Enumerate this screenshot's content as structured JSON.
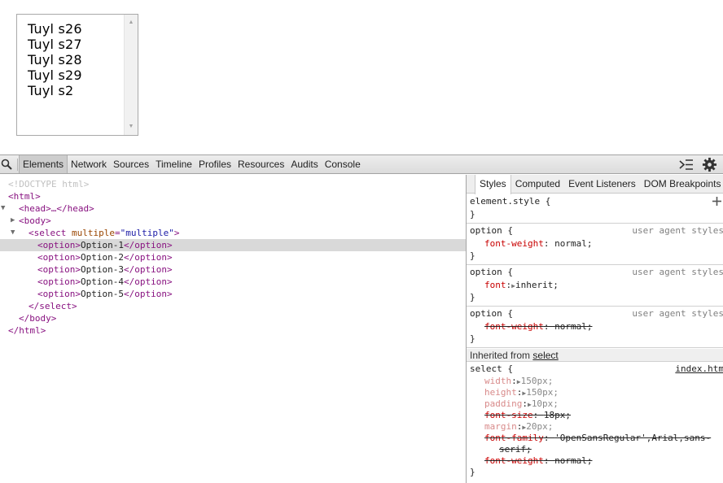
{
  "preview": {
    "options": [
      "Tuyl s26",
      "Tuyl s27",
      "Tuyl s28",
      "Tuyl s29",
      "Tuyl s2"
    ]
  },
  "toolbar": {
    "tabs": [
      "Elements",
      "Network",
      "Sources",
      "Timeline",
      "Profiles",
      "Resources",
      "Audits",
      "Console"
    ],
    "active_tab": "Elements"
  },
  "dom": {
    "doctype": "<!DOCTYPE html>",
    "html_open": "<html>",
    "head_collapsed": "<head>…</head>",
    "body_open": "<body>",
    "select_tag": "select",
    "select_attr_name": "multiple",
    "select_attr_value": "\"multiple\"",
    "options": [
      "Option-1",
      "Option-2",
      "Option-3",
      "Option-4",
      "Option-5"
    ],
    "option_open": "<option>",
    "option_close": "</option>",
    "select_close": "</select>",
    "body_close": "</body>",
    "html_close": "</html>"
  },
  "styles": {
    "subtabs": [
      "Styles",
      "Computed",
      "Event Listeners",
      "DOM Breakpoints"
    ],
    "element_style": "element.style {",
    "close_brace": "}",
    "rules": [
      {
        "selector": "option {",
        "source": "user agent styles",
        "prop": "font-weight",
        "value": "normal;"
      },
      {
        "selector": "option {",
        "source": "user agent styles",
        "prop": "font",
        "value": "inherit;"
      },
      {
        "selector": "option {",
        "source": "user agent styles",
        "prop": "font-weight",
        "value": "normal;"
      }
    ],
    "inherited_label": "Inherited from",
    "inherited_link": "select",
    "select_rule": {
      "selector": "select {",
      "source": "index.htm",
      "props": [
        {
          "name": "width",
          "value": "150px;"
        },
        {
          "name": "height",
          "value": "150px;"
        },
        {
          "name": "padding",
          "value": "10px;"
        },
        {
          "name": "font-size",
          "value": "18px;"
        },
        {
          "name": "margin",
          "value": "20px;"
        },
        {
          "name": "font-family",
          "value": "'OpenSansRegular',Arial,sans-",
          "value2": "serif;"
        },
        {
          "name": "font-weight",
          "value": "normal;"
        }
      ]
    }
  }
}
